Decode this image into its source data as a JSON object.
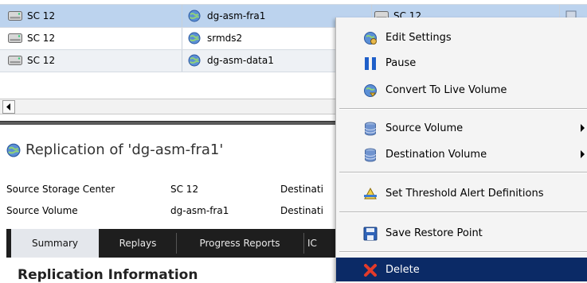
{
  "table": {
    "rows": [
      {
        "storage_center": "SC 12",
        "volume": "dg-asm-fra1",
        "col3": "SC 12"
      },
      {
        "storage_center": "SC 12",
        "volume": "srmds2"
      },
      {
        "storage_center": "SC 12",
        "volume": "dg-asm-data1"
      }
    ]
  },
  "detail": {
    "title": "Replication of 'dg-asm-fra1'",
    "fields": [
      {
        "label": "Source Storage Center",
        "value": "SC 12",
        "clipped": "Destinati"
      },
      {
        "label": "Source Volume",
        "value": "dg-asm-fra1",
        "clipped": "Destinati"
      }
    ],
    "tabs": [
      "Summary",
      "Replays",
      "Progress Reports",
      "IC"
    ],
    "section_heading": "Replication Information"
  },
  "context_menu": {
    "items": [
      {
        "label": "Edit Settings",
        "icon": "edit-settings-icon"
      },
      {
        "label": "Pause",
        "icon": "pause-icon"
      },
      {
        "label": "Convert To Live Volume",
        "icon": "live-volume-icon"
      },
      {
        "label": "Source Volume",
        "icon": "volume-icon",
        "submenu": true
      },
      {
        "label": "Destination Volume",
        "icon": "volume-icon",
        "submenu": true
      },
      {
        "label": "Set Threshold Alert Definitions",
        "icon": "threshold-icon"
      },
      {
        "label": "Save Restore Point",
        "icon": "save-icon"
      },
      {
        "label": "Delete",
        "icon": "delete-icon",
        "highlighted": true
      }
    ]
  },
  "colors": {
    "selected_row": "#bcd3ee",
    "menu_highlight": "#0b2a66",
    "tab_bar": "#1e1e1e"
  }
}
